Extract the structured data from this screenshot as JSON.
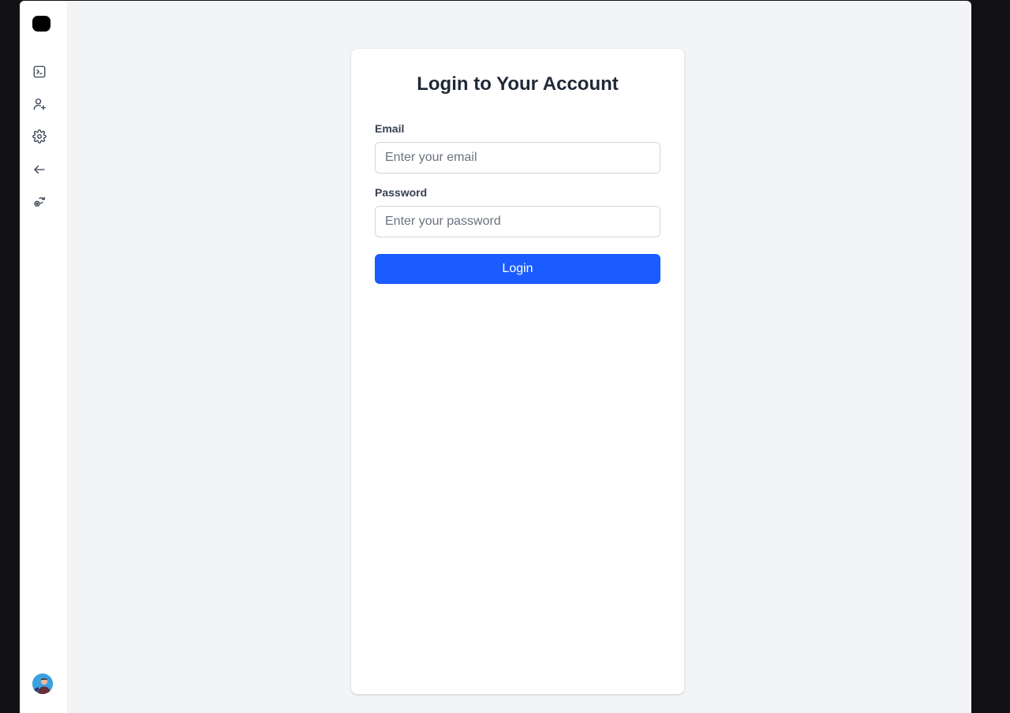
{
  "sidebar": {
    "items": [
      {
        "icon": "terminal-icon"
      },
      {
        "icon": "user-plus-icon"
      },
      {
        "icon": "gear-icon"
      },
      {
        "icon": "arrow-left-icon"
      },
      {
        "icon": "user-cog-icon"
      }
    ],
    "avatar_icon": "avatar"
  },
  "login": {
    "title": "Login to Your Account",
    "email_label": "Email",
    "email_value": "",
    "email_placeholder": "Enter your email",
    "password_label": "Password",
    "password_value": "",
    "password_placeholder": "Enter your password",
    "submit_label": "Login"
  },
  "colors": {
    "accent": "#1a5cff",
    "page_background": "#f3f4f6",
    "frame_background": "#121214"
  }
}
